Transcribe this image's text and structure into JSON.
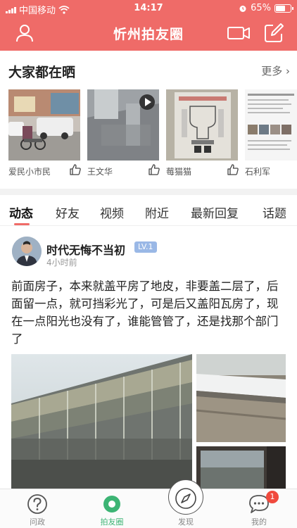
{
  "status_bar": {
    "carrier": "中国移动",
    "time": "14:17",
    "battery": "65%",
    "battery_level": 0.65
  },
  "header": {
    "title": "忻州拍友圈",
    "icons": [
      "user-icon",
      "video-camera-icon",
      "compose-icon"
    ]
  },
  "featured": {
    "title": "大家都在晒",
    "more_label": "更多",
    "items": [
      {
        "caption": "爱民小市民"
      },
      {
        "caption": "王文华"
      },
      {
        "caption": "莓猫猫"
      },
      {
        "caption": "石利军"
      }
    ]
  },
  "tabs": [
    {
      "label": "动态",
      "active": true
    },
    {
      "label": "好友"
    },
    {
      "label": "视频"
    },
    {
      "label": "附近"
    },
    {
      "label": "最新回复"
    },
    {
      "label": "话题"
    }
  ],
  "post": {
    "username": "时代无悔不当初",
    "level": "LV.1",
    "time": "4小时前",
    "text": "前面房子，本来就盖平房了地皮，非要盖二层了，后面留一点，就可挡彩光了，可是后又盖阳瓦房了，现在一点阳光也没有了，谁能管管了，还是找那个部门了"
  },
  "bottom_nav": [
    {
      "label": "问政",
      "icon": "question-icon"
    },
    {
      "label": "拍友圈",
      "icon": "moment-icon",
      "active": true
    },
    {
      "label": "发现",
      "icon": "compass-icon"
    },
    {
      "label": "我的",
      "icon": "chat-bubble-icon",
      "badge": "1"
    }
  ],
  "colors": {
    "brand": "#ef6b68",
    "active_tab": "#3cb474",
    "level_badge": "#9ab8e6",
    "notification": "#f04a3e"
  }
}
